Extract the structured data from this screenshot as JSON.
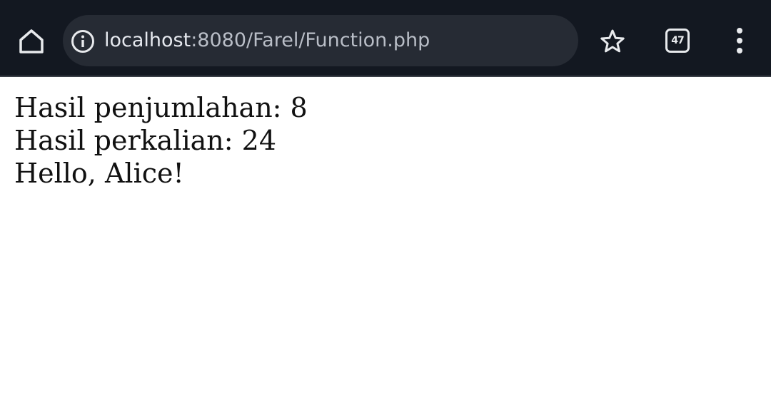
{
  "browser": {
    "url_host": "localhost",
    "url_path": ":8080/Farel/Function.php",
    "tab_count": "47",
    "icons": {
      "home": "home-icon",
      "info": "info-icon",
      "bookmark": "star-icon",
      "tabs": "tab-switcher-icon",
      "menu": "more-vert-icon"
    },
    "colors": {
      "toolbar_bg": "#131821",
      "omnibox_bg": "#262b34",
      "icon_color": "#e8eaed"
    }
  },
  "page": {
    "lines": [
      "Hasil penjumlahan: 8",
      "Hasil perkalian: 24",
      "Hello, Alice!"
    ]
  }
}
